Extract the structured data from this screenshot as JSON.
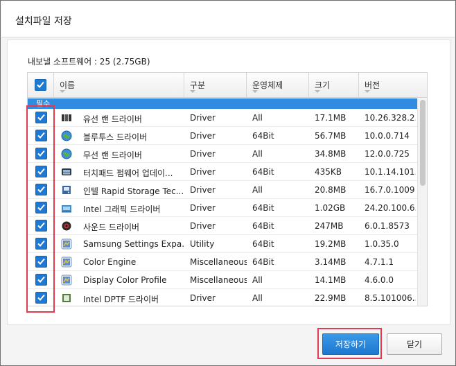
{
  "dialog": {
    "title": "설치파일 저장",
    "summary": "내보낼 소프트웨어 : 25 (2.75GB)"
  },
  "table": {
    "columns": [
      {
        "label": "이름"
      },
      {
        "label": "구분"
      },
      {
        "label": "운영체제"
      },
      {
        "label": "크기"
      },
      {
        "label": "버전"
      }
    ],
    "group_label": "필수",
    "rows": [
      {
        "name": "유선 랜 드라이버",
        "type": "Driver",
        "os": "All",
        "size": "17.1MB",
        "version": "10.26.328.2...",
        "icon": "ethernet-icon",
        "checked": true
      },
      {
        "name": "블루투스 드라이버",
        "type": "Driver",
        "os": "64Bit",
        "size": "56.7MB",
        "version": "10.0.0.714",
        "icon": "globe-icon",
        "checked": true
      },
      {
        "name": "무선 랜 드라이버",
        "type": "Driver",
        "os": "All",
        "size": "34.8MB",
        "version": "12.0.0.725",
        "icon": "globe-icon",
        "checked": true
      },
      {
        "name": "터치패드 펌웨어 업데이...",
        "type": "Driver",
        "os": "64Bit",
        "size": "435KB",
        "version": "10.1.14.101...",
        "icon": "touchpad-icon",
        "checked": true
      },
      {
        "name": "인텔 Rapid Storage Tec...",
        "type": "Driver",
        "os": "All",
        "size": "20.8MB",
        "version": "16.7.0.1009",
        "icon": "storage-icon",
        "checked": true
      },
      {
        "name": "Intel 그래픽 드라이버",
        "type": "Driver",
        "os": "64Bit",
        "size": "1.02GB",
        "version": "24.20.100.6...",
        "icon": "graphics-icon",
        "checked": true
      },
      {
        "name": "사운드 드라이버",
        "type": "Driver",
        "os": "64Bit",
        "size": "247MB",
        "version": "6.0.1.8573",
        "icon": "speaker-icon",
        "checked": true
      },
      {
        "name": "Samsung Settings Expa...",
        "type": "Utility",
        "os": "64Bit",
        "size": "19.2MB",
        "version": "1.0.35.0",
        "icon": "app-icon",
        "checked": true
      },
      {
        "name": "Color Engine",
        "type": "Miscellaneous",
        "os": "64Bit",
        "size": "3.14MB",
        "version": "4.7.1.1",
        "icon": "app-icon",
        "checked": true
      },
      {
        "name": "Display Color Profile",
        "type": "Miscellaneous",
        "os": "All",
        "size": "14.1MB",
        "version": "4.6.0.0",
        "icon": "app-icon",
        "checked": true
      },
      {
        "name": "Intel DPTF 드라이버",
        "type": "Driver",
        "os": "All",
        "size": "22.9MB",
        "version": "8.5.101006...",
        "icon": "chip-icon",
        "checked": true
      }
    ]
  },
  "buttons": {
    "save": "저장하기",
    "close": "닫기"
  },
  "colors": {
    "accent": "#1d79d3",
    "group_bar": "#2f8ce0",
    "highlight": "#e23b50"
  }
}
